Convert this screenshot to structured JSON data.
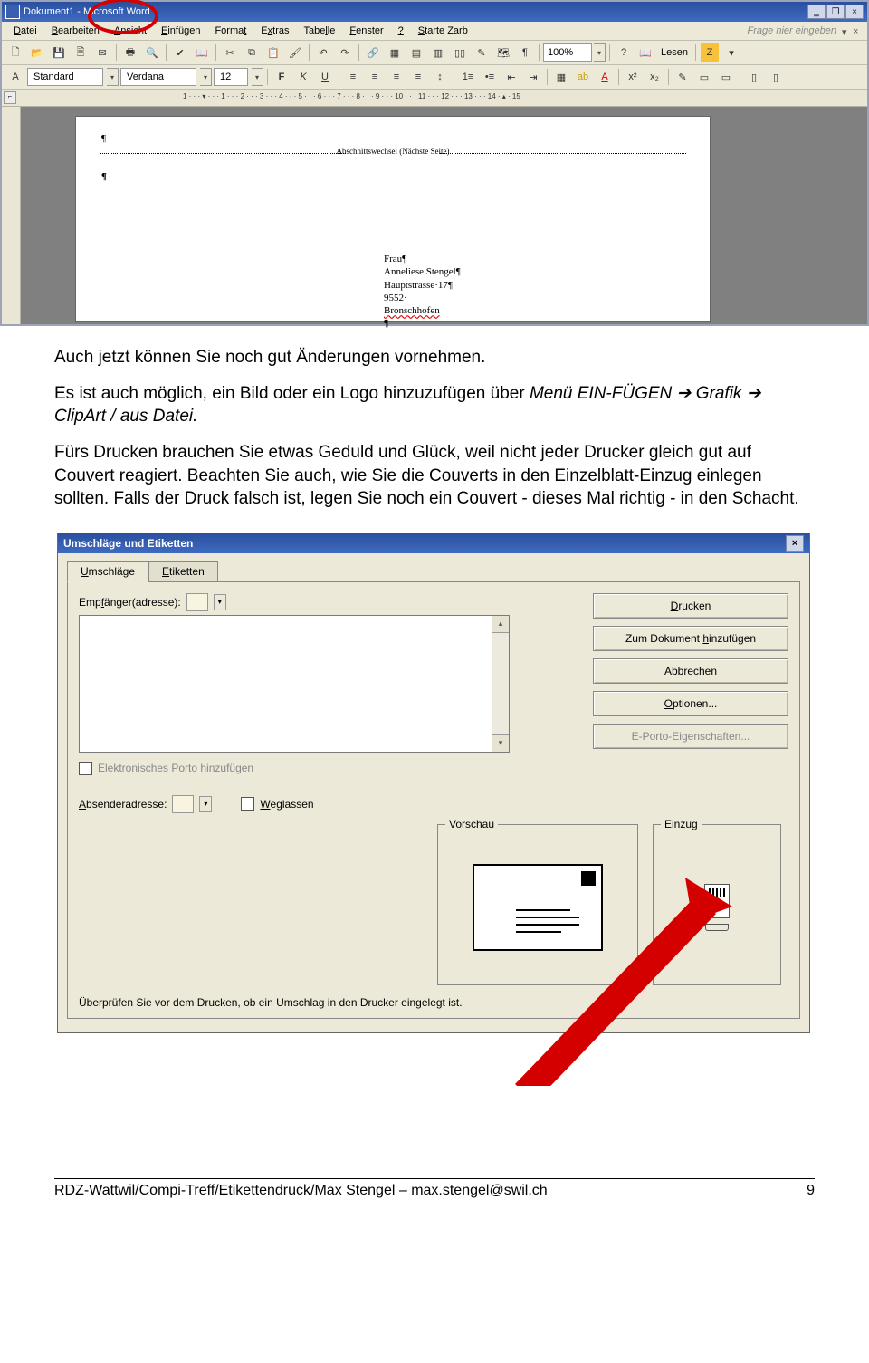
{
  "word": {
    "title": "Dokument1 - Microsoft Word",
    "menus": [
      "Datei",
      "Bearbeiten",
      "Ansicht",
      "Einfügen",
      "Format",
      "Extras",
      "Tabelle",
      "Fenster",
      "?",
      "Starte Zarb"
    ],
    "help_placeholder": "Frage hier eingeben",
    "zoom": "100%",
    "read_label": "Lesen",
    "style_combo": "Standard",
    "font_combo": "Verdana",
    "size_combo": "12",
    "section_break": "Abschnittswechsel (Nächste Seite)",
    "address": {
      "l1": "Frau¶",
      "l2": "Anneliese Stengel¶",
      "l3": "Hauptstrasse·17¶",
      "l4_a": "9552·",
      "l4_b": "Bronschhofen",
      "l4_c": "¶"
    },
    "ruler_h": "1 · · · ▾ · · · 1 · · · 2 · · · 3 · · · 4 · · · 5 · · · 6 · · · 7 · · · 8 · · · 9 · · · 10 · · · 11 · · · 12 · · · 13 · · · 14 · ▴ · 15"
  },
  "text": {
    "p1": "Auch jetzt können Sie noch gut Änderungen vornehmen.",
    "p2a": "Es ist auch möglich, ein Bild oder ein Logo hinzuzufügen über ",
    "p2b": "Menü EIN-FÜGEN ➔ Grafik ➔ ClipArt / aus Datei.",
    "p3": "Fürs Drucken brauchen Sie etwas Geduld und Glück, weil nicht jeder Drucker gleich gut auf Couvert reagiert. Beachten Sie auch, wie Sie die Couverts in den Einzelblatt-Einzug einlegen sollten. Falls der Druck falsch ist, legen Sie noch ein Couvert - dieses Mal richtig - in den Schacht."
  },
  "dialog": {
    "title": "Umschläge und Etiketten",
    "tabs": {
      "active": "Umschläge",
      "inactive": "Etiketten"
    },
    "recipient_label": "Empfänger(adresse):",
    "eporto_label": "Elektronisches Porto hinzufügen",
    "sender_label": "Absenderadresse:",
    "omit_label": "Weglassen",
    "buttons": {
      "print": "Drucken",
      "add": "Zum Dokument hinzufügen",
      "cancel": "Abbrechen",
      "options": "Optionen...",
      "eporto": "E-Porto-Eigenschaften..."
    },
    "preview_label": "Vorschau",
    "feed_label": "Einzug",
    "hint": "Überprüfen Sie vor dem Drucken, ob ein Umschlag in den Drucker eingelegt ist."
  },
  "footer": {
    "left": "RDZ-Wattwil/Compi-Treff/Etikettendruck/Max Stengel – max.stengel@swil.ch",
    "right": "9"
  }
}
